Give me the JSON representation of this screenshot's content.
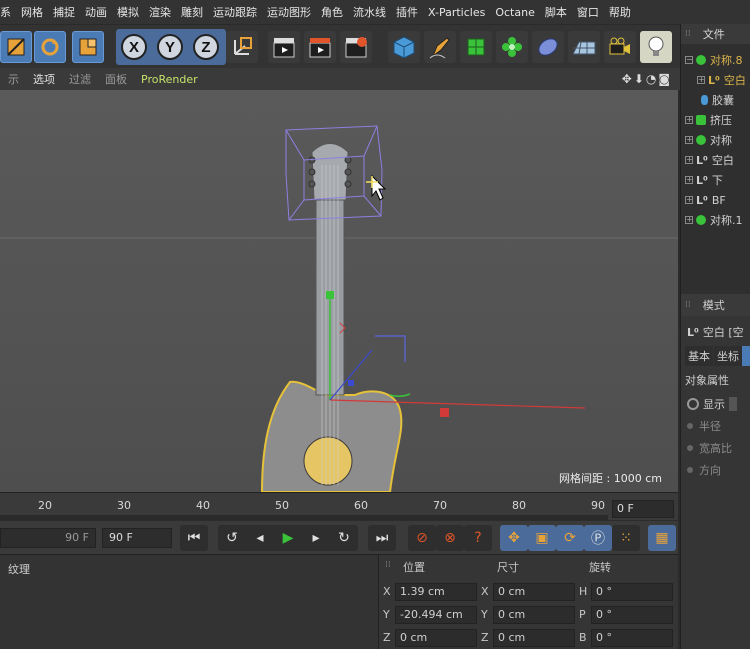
{
  "menu": [
    "系",
    "网格",
    "捕捉",
    "动画",
    "模拟",
    "渲染",
    "雕刻",
    "运动跟踪",
    "运动图形",
    "角色",
    "流水线",
    "插件",
    "X-Particles",
    "Octane",
    "脚本",
    "窗口",
    "帮助"
  ],
  "viewport_menu": {
    "item0": "示",
    "item1": "选项",
    "item2": "过滤",
    "item3": "面板",
    "item4": "ProRender"
  },
  "viewport": {
    "grid_spacing": "网格间距 : 1000 cm"
  },
  "object_manager": {
    "header": "文件",
    "objects": [
      {
        "name": "对称.8",
        "color": "#d8b24a"
      },
      {
        "name": "空白",
        "color": "#d8b24a"
      },
      {
        "name": "胶囊",
        "color": "#cfcfcf"
      },
      {
        "name": "挤压",
        "color": "#cfcfcf"
      },
      {
        "name": "对称",
        "color": "#cfcfcf"
      },
      {
        "name": "空白",
        "color": "#cfcfcf"
      },
      {
        "name": "下",
        "color": "#cfcfcf"
      },
      {
        "name": "BF",
        "color": "#cfcfcf"
      },
      {
        "name": "对称.1",
        "color": "#cfcfcf"
      }
    ]
  },
  "attributes": {
    "mode_label": "模式",
    "object_name": "空白 [空",
    "tab_basic": "基本",
    "tab_coord": "坐标",
    "section": "对象属性",
    "display_label": "显示",
    "radius_label": "半径",
    "aspect_label": "宽高比",
    "orientation_label": "方向"
  },
  "timeline": {
    "ticks": [
      "20",
      "30",
      "40",
      "50",
      "60",
      "70",
      "80",
      "90"
    ],
    "current_frame": "0 F"
  },
  "transport": {
    "end_frame_a": "90 F",
    "end_frame_b": "90 F"
  },
  "material_panel": {
    "label": "纹理"
  },
  "coordinates": {
    "position_header": "位置",
    "size_header": "尺寸",
    "rotation_header": "旋转",
    "pos_x": "1.39 cm",
    "pos_y": "-20.494 cm",
    "pos_z": "0 cm",
    "size_x": "0 cm",
    "size_y": "0 cm",
    "size_z": "0 cm",
    "rot_h": "0 °",
    "rot_p": "0 °",
    "rot_b": "0 °",
    "label_x": "X",
    "label_y": "Y",
    "label_z": "Z",
    "label_h": "H",
    "label_p": "P",
    "label_b": "B"
  },
  "colors": {
    "accent_blue": "#4b7bb5",
    "axis_red": "#d23a3a",
    "axis_green": "#3ac23a",
    "axis_blue": "#3a4ad2",
    "selection_purple": "#8e7fe0",
    "prorender_green": "#c6e26a"
  }
}
